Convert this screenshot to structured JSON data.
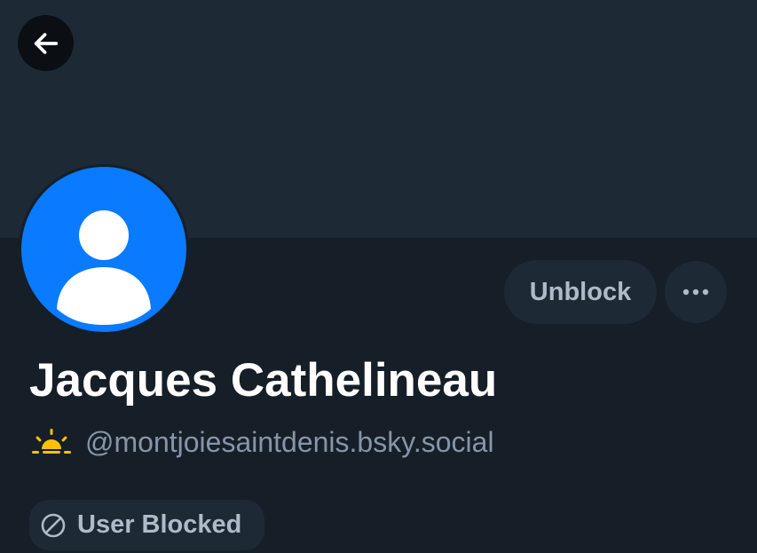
{
  "profile": {
    "display_name": "Jacques Cathelineau",
    "handle": "@montjoiesaintdenis.bsky.social",
    "blocked_label": "User Blocked"
  },
  "actions": {
    "unblock_label": "Unblock"
  },
  "icons": {
    "back": "arrow-left-icon",
    "more": "ellipsis-icon",
    "handle_prefix": "sunrise-emoji-icon",
    "blocked": "ban-icon",
    "avatar": "default-user-avatar-icon"
  },
  "colors": {
    "background": "#161e27",
    "banner": "#1e2936",
    "avatar": "#0a7aff",
    "button_bg": "#1e2936",
    "button_text": "#aebbc9",
    "handle_text": "#8696a8",
    "name_text": "#ffffff",
    "emoji_accent": "#ffc107"
  }
}
